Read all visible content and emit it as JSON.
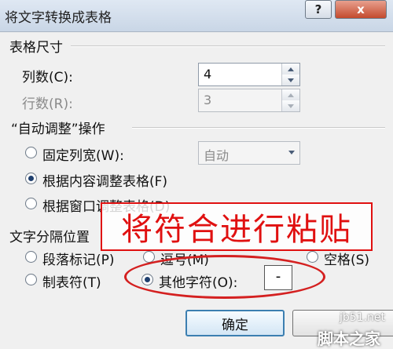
{
  "window": {
    "title": "将文字转换成表格",
    "help_label": "?",
    "close_label": "x"
  },
  "table_size": {
    "section_label": "表格尺寸",
    "columns_label": "列数(C):",
    "columns_value": "4",
    "rows_label": "行数(R):",
    "rows_value": "3"
  },
  "autofit": {
    "section_label": "“自动调整”操作",
    "fixed_width_label": "固定列宽(W):",
    "fixed_width_value": "自动",
    "fit_content_label": "根据内容调整表格(F)",
    "fit_window_label": "根据窗口调整表格(D)",
    "selected": "fit_content"
  },
  "separator": {
    "section_label": "文字分隔位置",
    "paragraph_label": "段落标记(P)",
    "comma_label": "逗号(M)",
    "space_label": "空格(S)",
    "tab_label": "制表符(T)",
    "other_label": "其他字符(O):",
    "other_value": "-",
    "selected": "other"
  },
  "annotation": {
    "text": "将符合进行粘贴",
    "color": "#e01010"
  },
  "buttons": {
    "ok_label": "确定"
  },
  "watermark": {
    "line1": "jb51.net",
    "line2": "脚本之家"
  }
}
